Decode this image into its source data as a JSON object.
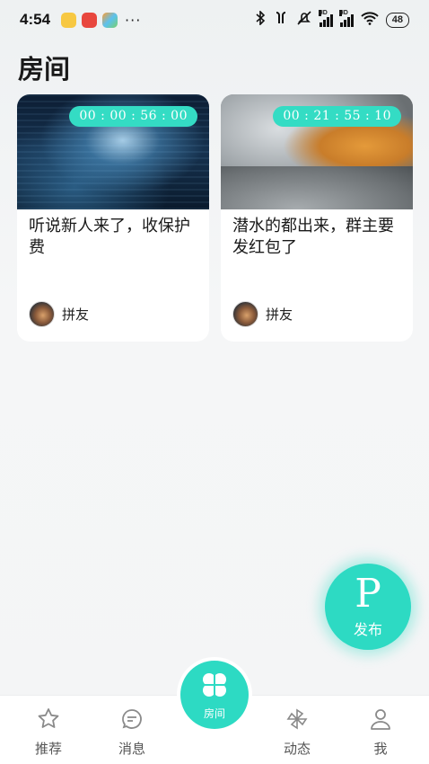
{
  "status_bar": {
    "time": "4:54",
    "more": "···",
    "battery": "48",
    "hd_1": "HD",
    "hd_2": "HD"
  },
  "header": {
    "title": "房间"
  },
  "rooms": [
    {
      "timer": "00 : 00 : 56 : 00",
      "title": "听说新人来了，收保护费",
      "user": "拼友"
    },
    {
      "timer": "00 : 21 : 55 : 10",
      "title": "潜水的都出来，群主要发红包了",
      "user": "拼友"
    }
  ],
  "fab": {
    "letter": "P",
    "label": "发布"
  },
  "bottom_nav": {
    "recommend": "推荐",
    "messages": "消息",
    "rooms": "房间",
    "activity": "动态",
    "me": "我"
  },
  "colors": {
    "accent": "#2ddac3",
    "timer": "#34dcc4"
  }
}
